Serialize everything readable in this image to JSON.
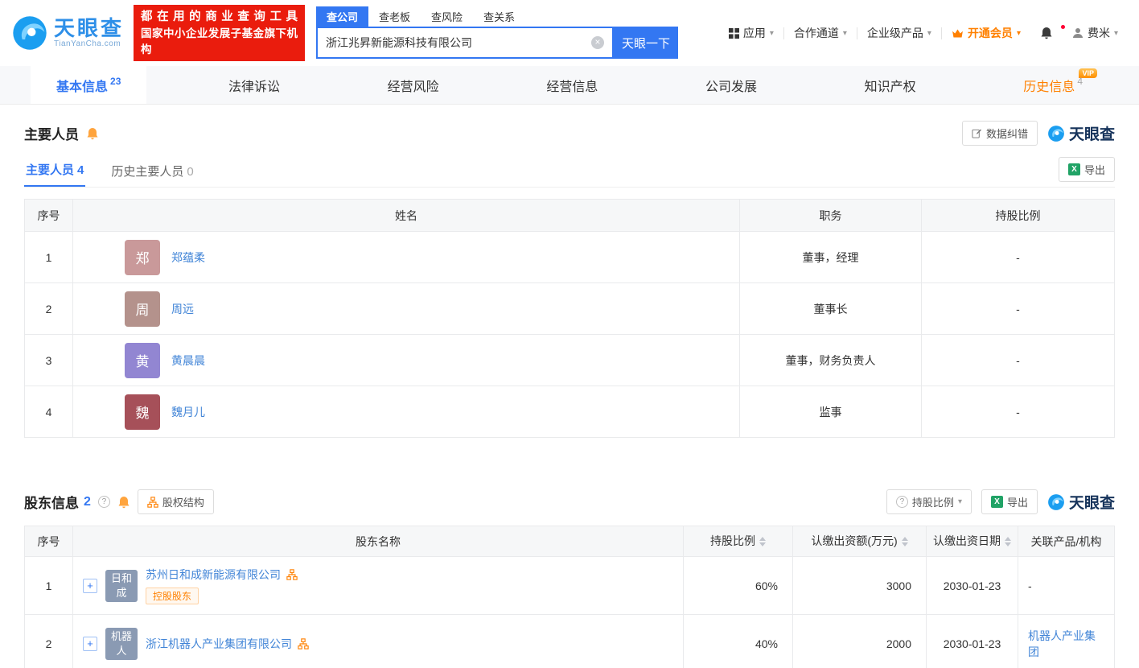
{
  "brand": {
    "name": "天眼查",
    "domain": "TianYanCha.com"
  },
  "banner": {
    "line1": "都在用的商业查询工具",
    "line2": "国家中小企业发展子基金旗下机构"
  },
  "search": {
    "tabs": [
      {
        "label": "查公司"
      },
      {
        "label": "查老板"
      },
      {
        "label": "查风险"
      },
      {
        "label": "查关系"
      }
    ],
    "value": "浙江兆昇新能源科技有限公司",
    "button": "天眼一下"
  },
  "nav": {
    "apps": "应用",
    "channel": "合作通道",
    "enterprise": "企业级产品",
    "member": "开通会员",
    "user": "费米"
  },
  "tabbar": [
    {
      "label": "基本信息",
      "count": "23"
    },
    {
      "label": "法律诉讼"
    },
    {
      "label": "经营风险"
    },
    {
      "label": "经营信息"
    },
    {
      "label": "公司发展"
    },
    {
      "label": "知识产权"
    },
    {
      "label": "历史信息",
      "count": "4",
      "badge": "VIP"
    }
  ],
  "staff": {
    "title": "主要人员",
    "correction": "数据纠错",
    "export": "导出",
    "subtabs": [
      {
        "label": "主要人员",
        "count": "4"
      },
      {
        "label": "历史主要人员",
        "count": "0"
      }
    ],
    "headers": [
      "序号",
      "姓名",
      "职务",
      "持股比例"
    ],
    "rows": [
      {
        "no": "1",
        "initial": "郑",
        "color": "#c9999a",
        "name": "郑蕴柔",
        "position": "董事，经理",
        "ratio": "-"
      },
      {
        "no": "2",
        "initial": "周",
        "color": "#b4928c",
        "name": "周远",
        "position": "董事长",
        "ratio": "-"
      },
      {
        "no": "3",
        "initial": "黄",
        "color": "#9286d2",
        "name": "黄晨晨",
        "position": "董事，财务负责人",
        "ratio": "-"
      },
      {
        "no": "4",
        "initial": "魏",
        "color": "#a65059",
        "name": "魏月儿",
        "position": "监事",
        "ratio": "-"
      }
    ]
  },
  "shareholders": {
    "title": "股东信息",
    "count": "2",
    "equity_button": "股权结构",
    "sort_button": "持股比例",
    "export": "导出",
    "headers": [
      "序号",
      "股东名称",
      "持股比例",
      "认缴出资额(万元)",
      "认缴出资日期",
      "关联产品/机构"
    ],
    "rows": [
      {
        "no": "1",
        "abbr": "日和成",
        "color": "#8a9ab3",
        "name": "苏州日和成新能源有限公司",
        "tag": "控股股东",
        "ratio": "60%",
        "amount": "3000",
        "date": "2030-01-23",
        "related": "-"
      },
      {
        "no": "2",
        "abbr": "机器人",
        "color": "#8a9ab3",
        "name": "浙江机器人产业集团有限公司",
        "ratio": "40%",
        "amount": "2000",
        "date": "2030-01-23",
        "related": "机器人产业集团"
      }
    ]
  },
  "colors": {
    "accent": "#3377f2",
    "orange": "#ff8000",
    "red": "#ea1c0d",
    "link": "#4285d7",
    "excel_green": "#21a366"
  }
}
